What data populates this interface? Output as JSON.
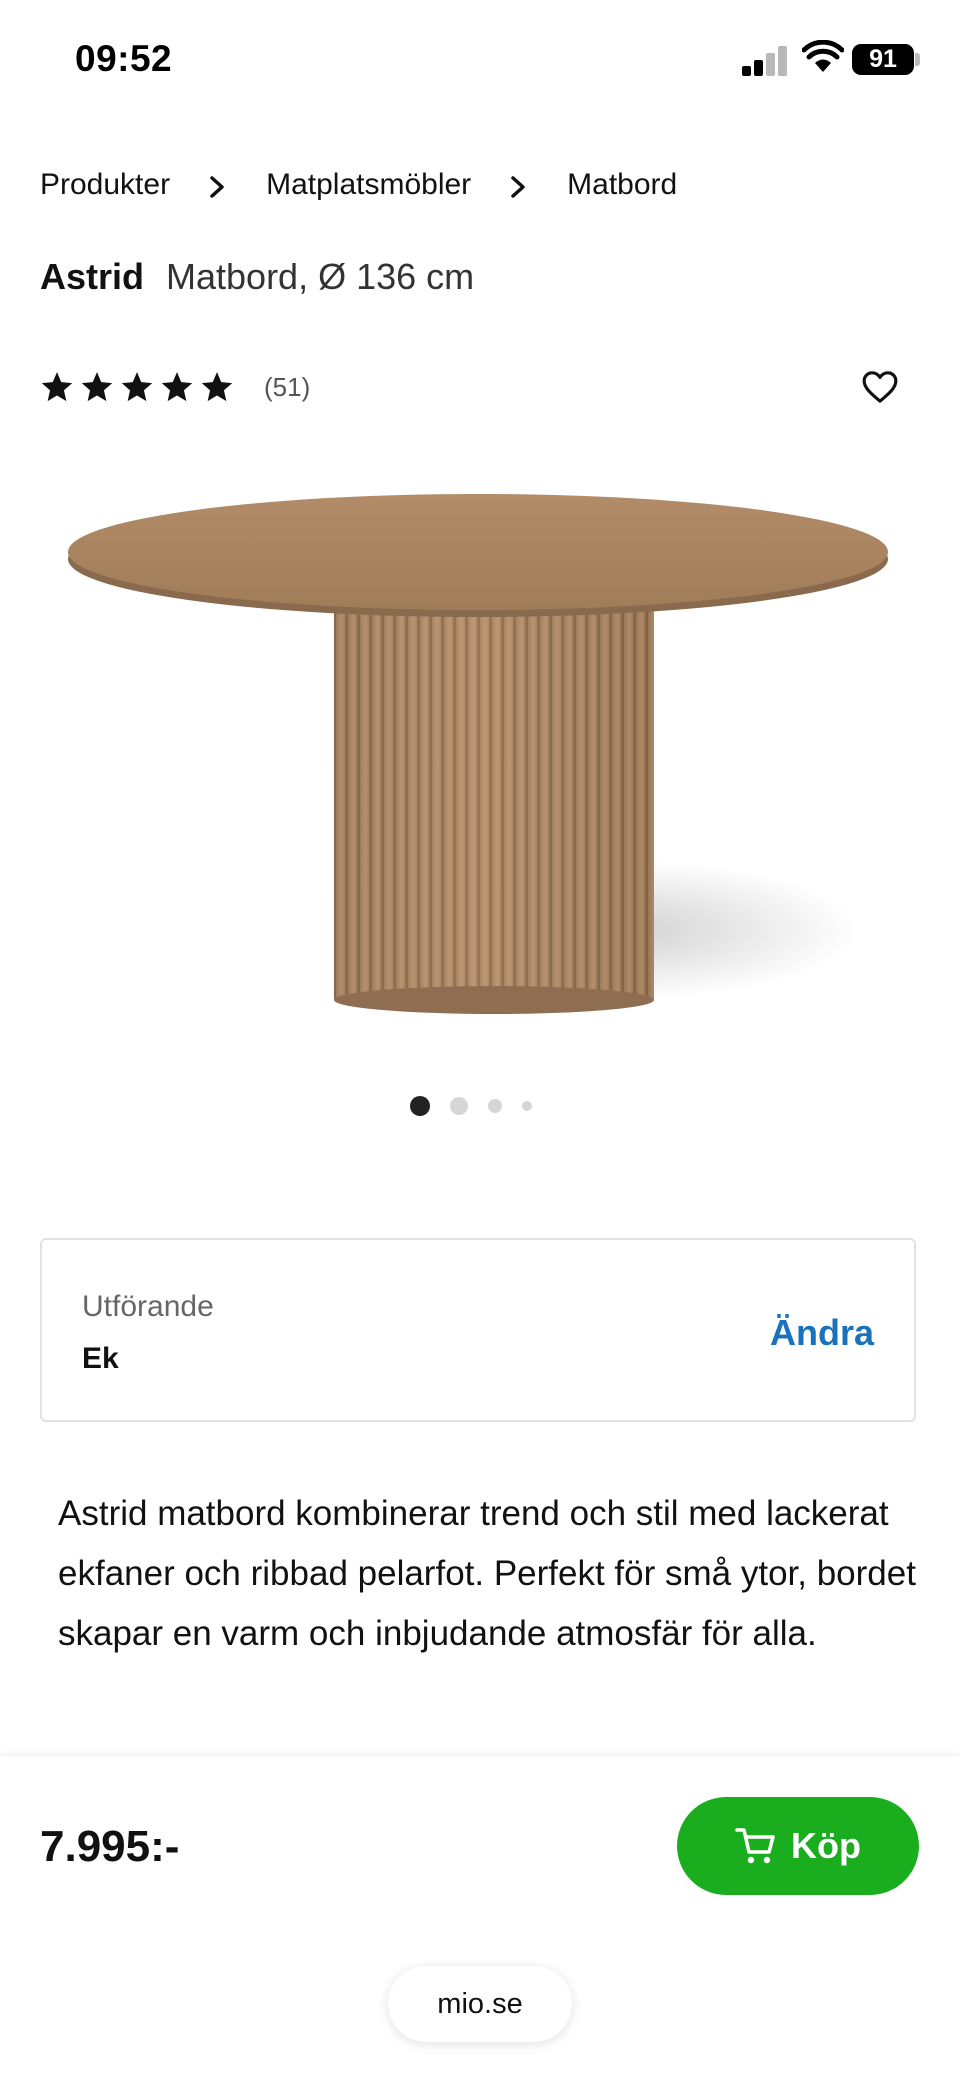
{
  "status_bar": {
    "time": "09:52",
    "battery": "91"
  },
  "breadcrumb": {
    "items": [
      "Produkter",
      "Matplatsmöbler",
      "Matbord"
    ]
  },
  "product": {
    "name": "Astrid",
    "subtitle": "Matbord, Ø 136 cm",
    "rating_stars": 5,
    "review_count": "(51)",
    "image_dots": 4,
    "active_dot": 0
  },
  "variant": {
    "label": "Utförande",
    "value": "Ek",
    "change_label": "Ändra"
  },
  "description": "Astrid matbord kombinerar trend och stil med lackerat ekfaner och ribbad pelarfot. Perfekt för små ytor, bordet skapar en varm och inbjudande atmosfär för alla.",
  "purchase": {
    "price": "7.995:-",
    "buy_label": "Köp",
    "accent": "#1aad1e"
  },
  "browser": {
    "url": "mio.se"
  },
  "colors": {
    "link": "#1a72bc"
  }
}
